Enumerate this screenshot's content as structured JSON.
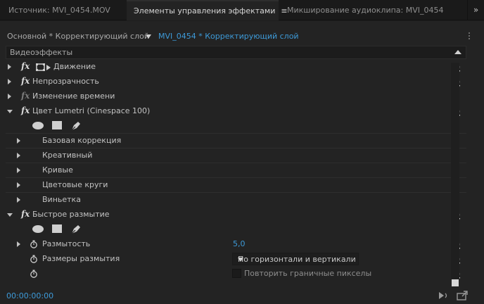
{
  "tabs": [
    {
      "label": "Источник: MVI_0454.MOV",
      "active": false
    },
    {
      "label": "Элементы управления эффектами",
      "active": true
    },
    {
      "label": "Микширование аудиоклипа: MVI_0454",
      "active": false
    }
  ],
  "tab_menu_icon": "≡",
  "overflow_icon": "»",
  "header": {
    "source": "Основной * Корректирующий слой",
    "clip": "MVI_0454 * Корректирующий слой"
  },
  "section_label": "Видеоэффекты",
  "effects": {
    "motion": "Движение",
    "opacity": "Непрозрачность",
    "time_remap": "Изменение времени",
    "lumetri": "Цвет Lumetri (Cinespace 100)",
    "lumetri_sub": [
      "Базовая коррекция",
      "Креативный",
      "Кривые",
      "Цветовые круги",
      "Виньетка"
    ],
    "blur": "Быстрое размытие",
    "blurriness_label": "Размытость",
    "blurriness_value": "5,0",
    "dimensions_label": "Размеры размытия",
    "dimensions_value": "По горизонтали и вертикали",
    "repeat_edge_label": "Повторить граничные пикселы"
  },
  "fx_glyph": "fx",
  "timecode": "00:00:00:00",
  "colors": {
    "accent": "#3d9ad8",
    "panel": "#232323",
    "background": "#1e1e1e"
  }
}
